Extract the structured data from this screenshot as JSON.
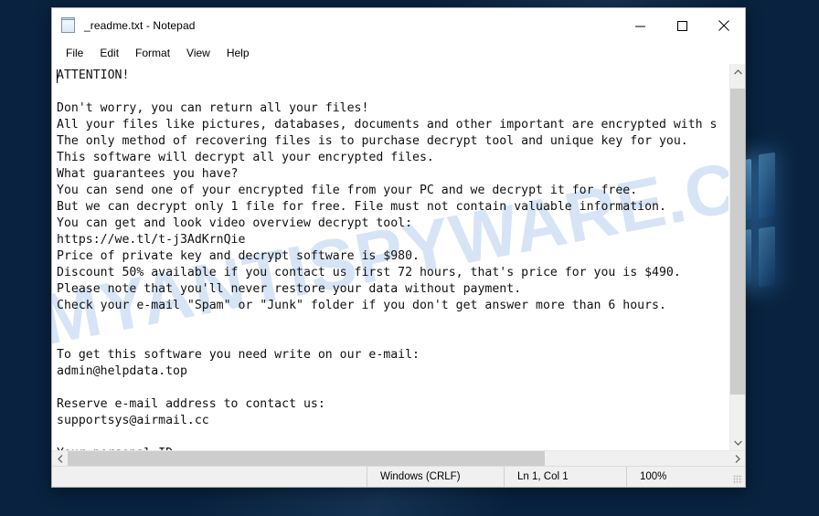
{
  "window": {
    "title": "_readme.txt - Notepad",
    "icon": "notepad-icon",
    "controls": {
      "minimize": "minimize-icon",
      "maximize": "maximize-icon",
      "close": "close-icon"
    }
  },
  "menu": {
    "items": [
      {
        "label": "File"
      },
      {
        "label": "Edit"
      },
      {
        "label": "Format"
      },
      {
        "label": "View"
      },
      {
        "label": "Help"
      }
    ]
  },
  "editor": {
    "watermark": "MYANTISPYWARE.COM",
    "text": "ATTENTION!\n\nDon't worry, you can return all your files!\nAll your files like pictures, databases, documents and other important are encrypted with s\nThe only method of recovering files is to purchase decrypt tool and unique key for you.\nThis software will decrypt all your encrypted files.\nWhat guarantees you have?\nYou can send one of your encrypted file from your PC and we decrypt it for free.\nBut we can decrypt only 1 file for free. File must not contain valuable information.\nYou can get and look video overview decrypt tool:\nhttps://we.tl/t-j3AdKrnQie\nPrice of private key and decrypt software is $980.\nDiscount 50% available if you contact us first 72 hours, that's price for you is $490.\nPlease note that you'll never restore your data without payment.\nCheck your e-mail \"Spam\" or \"Junk\" folder if you don't get answer more than 6 hours.\n\n\nTo get this software you need write on our e-mail:\nadmin@helpdata.top\n\nReserve e-mail address to contact us:\nsupportsys@airmail.cc\n\nYour personal ID:",
    "scroll": {
      "up_arrow": "chevron-up-icon",
      "down_arrow": "chevron-down-icon",
      "left_arrow": "chevron-left-icon",
      "right_arrow": "chevron-right-icon"
    }
  },
  "status_bar": {
    "encoding": "Windows (CRLF)",
    "position": "Ln 1, Col 1",
    "zoom": "100%"
  },
  "colors": {
    "desktop": "#09223f",
    "window_bg": "#ffffff",
    "status_bg": "#f0f0f0",
    "scrollbar_thumb": "#cdcdcd",
    "watermark": "#78a5e1"
  }
}
